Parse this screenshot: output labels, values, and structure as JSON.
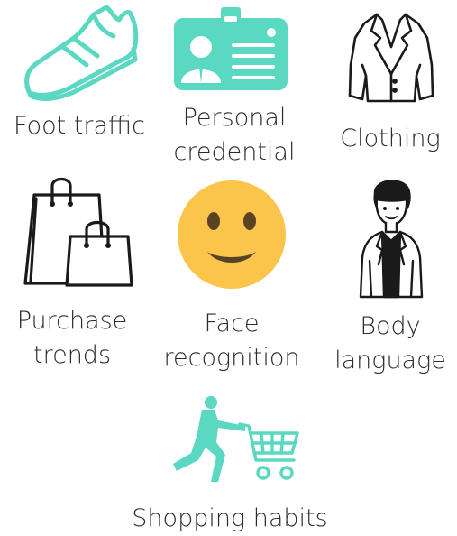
{
  "colors": {
    "teal": "#5ad8c1",
    "yellow": "#fbc54b",
    "outline": "#1a1a1a"
  },
  "items": [
    {
      "icon": "sneaker-icon",
      "label_lines": [
        "Foot traffic"
      ]
    },
    {
      "icon": "id-badge-icon",
      "label_lines": [
        "Personal",
        "credential"
      ]
    },
    {
      "icon": "jacket-icon",
      "label_lines": [
        "Clothing"
      ]
    },
    {
      "icon": "shopping-bags-icon",
      "label_lines": [
        "Purchase",
        "trends"
      ]
    },
    {
      "icon": "smiley-face-icon",
      "label_lines": [
        "Face",
        "recognition"
      ]
    },
    {
      "icon": "person-icon",
      "label_lines": [
        "Body",
        "language"
      ]
    },
    {
      "icon": "person-with-cart-icon",
      "label_lines": [
        "Shopping habits"
      ]
    }
  ]
}
